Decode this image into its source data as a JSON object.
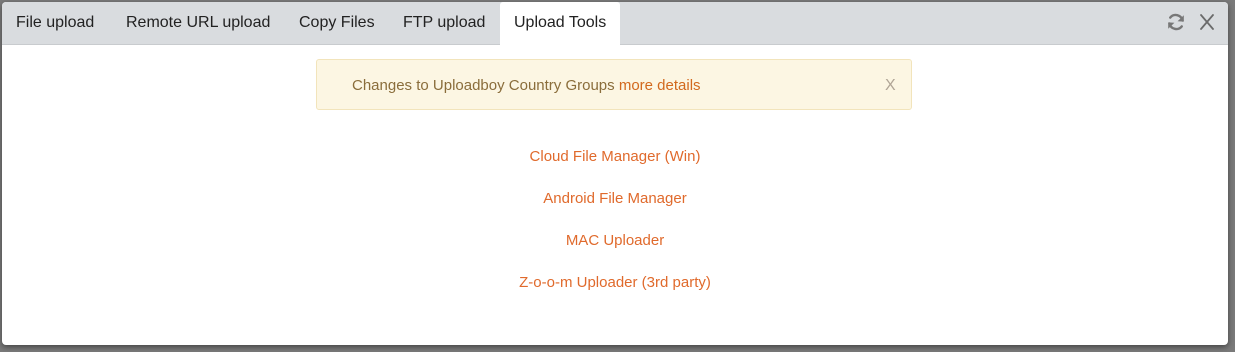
{
  "tabs": [
    {
      "label": "File upload"
    },
    {
      "label": "Remote URL upload"
    },
    {
      "label": "Copy Files"
    },
    {
      "label": "FTP upload"
    },
    {
      "label": "Upload Tools"
    }
  ],
  "active_tab": "Upload Tools",
  "toolbar": {
    "refresh_icon": "refresh-icon",
    "close_label": "X"
  },
  "alert": {
    "text": "Changes to Uploadboy Country Groups ",
    "link": "more details",
    "close_label": "X"
  },
  "tools": [
    {
      "label": "Cloud File Manager (Win)"
    },
    {
      "label": "Android File Manager"
    },
    {
      "label": "MAC Uploader"
    },
    {
      "label": "Z-o-o-m Uploader (3rd party)"
    }
  ],
  "colors": {
    "accent": "#e06a2c",
    "alert_bg": "#fcf6e3",
    "alert_text": "#8a6d3b",
    "tabbar_bg": "#d9dcdf"
  }
}
